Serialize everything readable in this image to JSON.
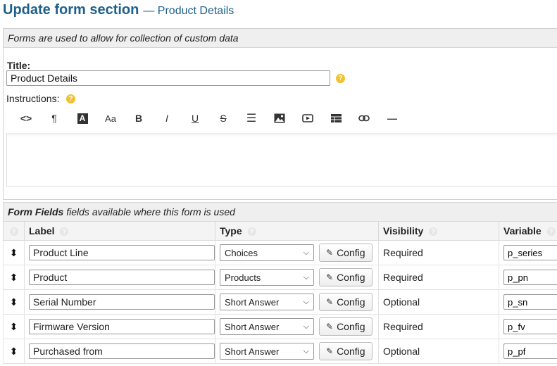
{
  "header": {
    "title": "Update form section",
    "subtitle": "— Product Details"
  },
  "panel": {
    "description": "Forms are used to allow for collection of custom data"
  },
  "title_field": {
    "label": "Title:",
    "value": "Product Details",
    "help": "?"
  },
  "instructions": {
    "label": "Instructions:",
    "help": "?"
  },
  "toolbar": {
    "code_view": "<>",
    "paragraph": "¶",
    "text_color": "A",
    "font_size": "Aa",
    "bold": "B",
    "italic": "I",
    "underline": "U",
    "strikethrough": "S",
    "list": "☰",
    "image": "image",
    "video": "video",
    "table": "table",
    "link": "link",
    "hr": "—"
  },
  "form_fields": {
    "title": "Form Fields",
    "subtitle": "fields available where this form is used",
    "columns": {
      "label": "Label",
      "type": "Type",
      "visibility": "Visibility",
      "variable": "Variable"
    },
    "config_label": "Config",
    "rows": [
      {
        "label": "Product Line",
        "type": "Choices",
        "visibility": "Required",
        "variable": "p_series"
      },
      {
        "label": "Product",
        "type": "Products",
        "visibility": "Required",
        "variable": "p_pn"
      },
      {
        "label": "Serial Number",
        "type": "Short Answer",
        "visibility": "Optional",
        "variable": "p_sn"
      },
      {
        "label": "Firmware Version",
        "type": "Short Answer",
        "visibility": "Required",
        "variable": "p_fv"
      },
      {
        "label": "Purchased from",
        "type": "Short Answer",
        "visibility": "Optional",
        "variable": "p_pf"
      }
    ]
  },
  "colors": {
    "heading": "#1f5f8b",
    "help_icon": "#f2c12e",
    "header_bg": "#efefef"
  }
}
